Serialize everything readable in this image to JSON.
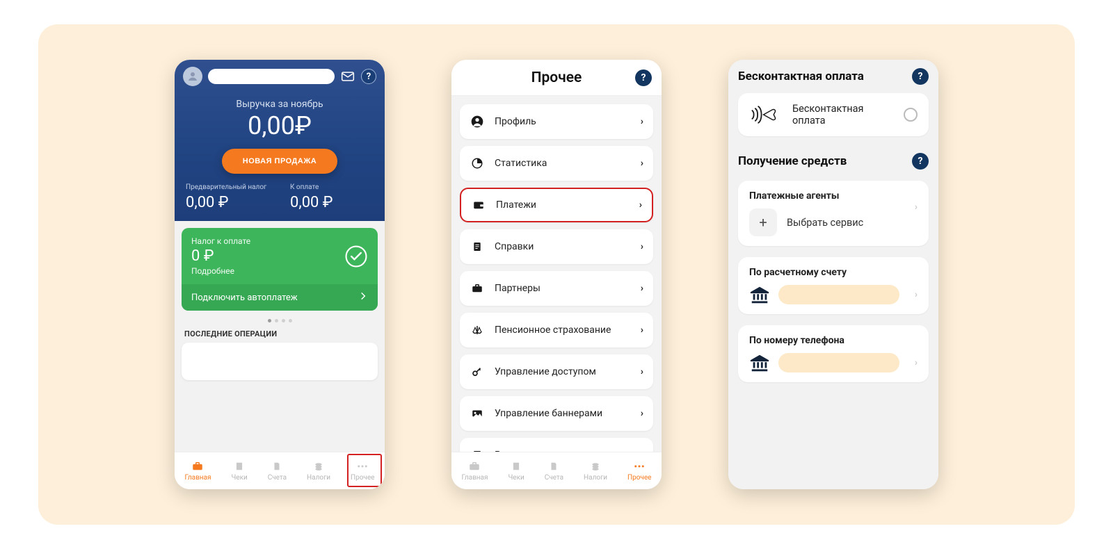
{
  "screen1": {
    "revenue_label": "Выручка за ноябрь",
    "revenue_amount": "0,00₽",
    "new_sale_button": "НОВАЯ ПРОДАЖА",
    "pretax_label": "Предварительный налог",
    "pretax_value": "0,00 ₽",
    "topay_label": "К оплате",
    "topay_value": "0,00 ₽",
    "green_label": "Налог к оплате",
    "green_amount": "0 ₽",
    "green_more": "Подробнее",
    "green_autopay": "Подключить автоплатеж",
    "section_last_ops": "ПОСЛЕДНИЕ ОПЕРАЦИИ"
  },
  "nav": {
    "main": "Главная",
    "receipts": "Чеки",
    "invoices": "Счета",
    "taxes": "Налоги",
    "other": "Прочее"
  },
  "screen2": {
    "title": "Прочее",
    "items": [
      {
        "label": "Профиль",
        "icon": "person"
      },
      {
        "label": "Статистика",
        "icon": "piechart"
      },
      {
        "label": "Платежи",
        "icon": "wallet"
      },
      {
        "label": "Справки",
        "icon": "doc"
      },
      {
        "label": "Партнеры",
        "icon": "briefcase"
      },
      {
        "label": "Пенсионное страхование",
        "icon": "scales"
      },
      {
        "label": "Управление доступом",
        "icon": "key"
      },
      {
        "label": "Управление баннерами",
        "icon": "banner"
      },
      {
        "label": "Редактор чека",
        "icon": "receipt"
      }
    ]
  },
  "screen3": {
    "section1_title": "Бесконтактная оплата",
    "contactless_label": "Бесконтактная оплата",
    "section2_title": "Получение средств",
    "agents_title": "Платежные агенты",
    "agents_choose": "Выбрать сервис",
    "by_account_title": "По расчетному счету",
    "by_phone_title": "По номеру телефона"
  }
}
